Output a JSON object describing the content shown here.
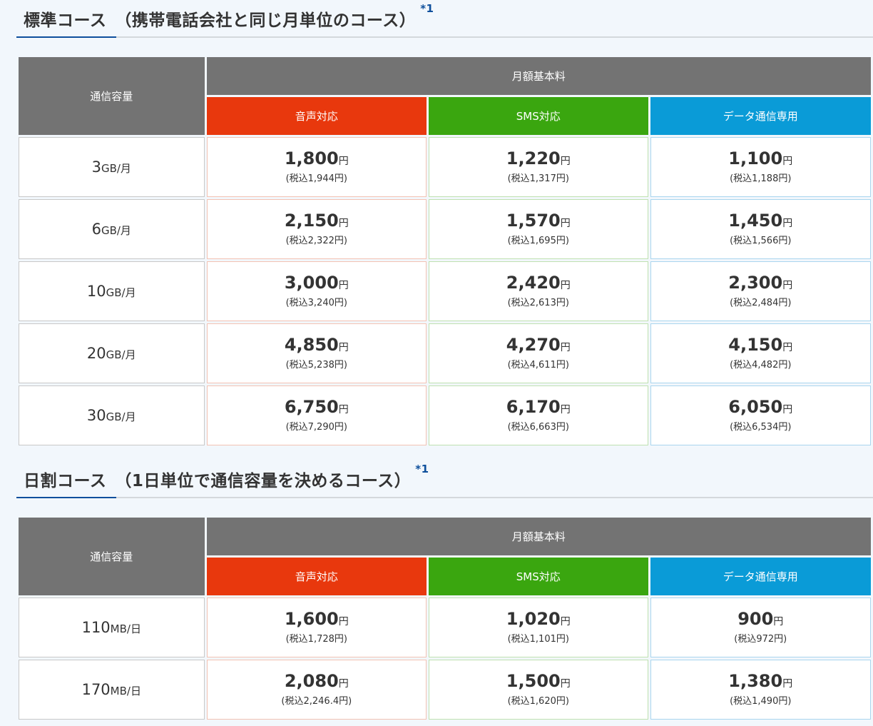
{
  "sections": [
    {
      "title": "標準コース　（携帯電話会社と同じ月単位のコース）",
      "note": "*1",
      "header": {
        "capacity": "通信容量",
        "fee": "月額基本料",
        "voice": "音声対応",
        "sms": "SMS対応",
        "data": "データ通信専用"
      },
      "rows": [
        {
          "cap_num": "3",
          "cap_unit": "GB/月",
          "voice": "1,800",
          "voice_tax": "(税込1,944円)",
          "sms": "1,220",
          "sms_tax": "(税込1,317円)",
          "data": "1,100",
          "data_tax": "(税込1,188円)"
        },
        {
          "cap_num": "6",
          "cap_unit": "GB/月",
          "voice": "2,150",
          "voice_tax": "(税込2,322円)",
          "sms": "1,570",
          "sms_tax": "(税込1,695円)",
          "data": "1,450",
          "data_tax": "(税込1,566円)"
        },
        {
          "cap_num": "10",
          "cap_unit": "GB/月",
          "voice": "3,000",
          "voice_tax": "(税込3,240円)",
          "sms": "2,420",
          "sms_tax": "(税込2,613円)",
          "data": "2,300",
          "data_tax": "(税込2,484円)"
        },
        {
          "cap_num": "20",
          "cap_unit": "GB/月",
          "voice": "4,850",
          "voice_tax": "(税込5,238円)",
          "sms": "4,270",
          "sms_tax": "(税込4,611円)",
          "data": "4,150",
          "data_tax": "(税込4,482円)"
        },
        {
          "cap_num": "30",
          "cap_unit": "GB/月",
          "voice": "6,750",
          "voice_tax": "(税込7,290円)",
          "sms": "6,170",
          "sms_tax": "(税込6,663円)",
          "data": "6,050",
          "data_tax": "(税込6,534円)"
        }
      ]
    },
    {
      "title": "日割コース　（1日単位で通信容量を決めるコース）",
      "note": "*1",
      "header": {
        "capacity": "通信容量",
        "fee": "月額基本料",
        "voice": "音声対応",
        "sms": "SMS対応",
        "data": "データ通信専用"
      },
      "rows": [
        {
          "cap_num": "110",
          "cap_unit": "MB/日",
          "voice": "1,600",
          "voice_tax": "(税込1,728円)",
          "sms": "1,020",
          "sms_tax": "(税込1,101円)",
          "data": "900",
          "data_tax": "(税込972円)"
        },
        {
          "cap_num": "170",
          "cap_unit": "MB/日",
          "voice": "2,080",
          "voice_tax": "(税込2,246.4円)",
          "sms": "1,500",
          "sms_tax": "(税込1,620円)",
          "data": "1,380",
          "data_tax": "(税込1,490円)"
        }
      ]
    }
  ],
  "yen": "円",
  "colors": {
    "header_gray": "#737373",
    "voice": "#e8380d",
    "sms": "#3aa60f",
    "data": "#0a9bd7",
    "accent_underline": "#0e4f9c"
  }
}
